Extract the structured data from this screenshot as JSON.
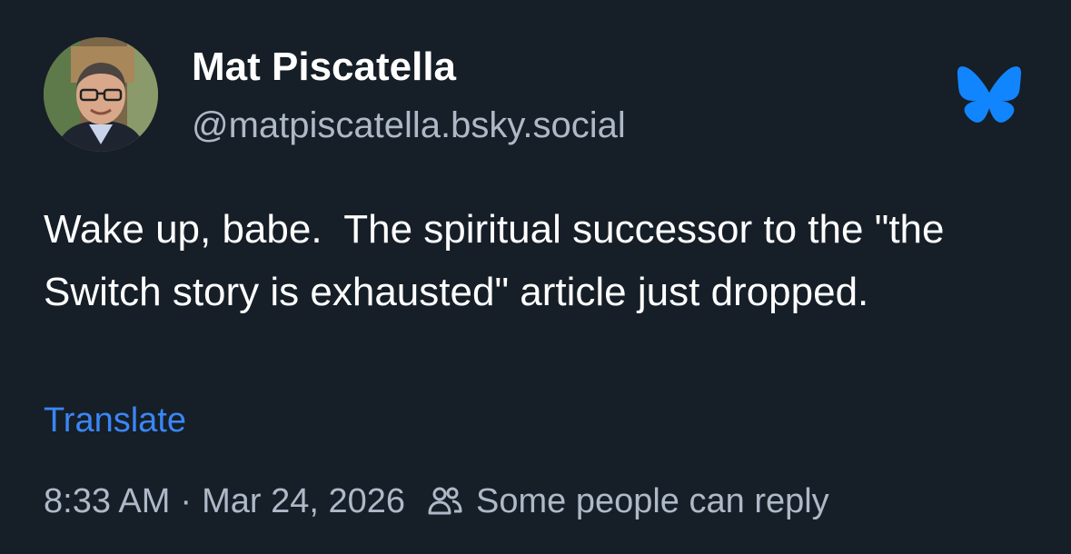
{
  "author": {
    "display_name": "Mat Piscatella",
    "handle": "@matpiscatella.bsky.social",
    "avatar_icon": "profile-photo"
  },
  "app": {
    "logo_icon": "bluesky-butterfly-icon",
    "accent_color": "#1185fe"
  },
  "post": {
    "text": "Wake up, babe.  The spiritual successor to the \"the Switch story is exhausted\" article just dropped.",
    "translate_label": "Translate"
  },
  "meta": {
    "time": "8:33 AM",
    "separator": "·",
    "date": "Mar 24, 2026",
    "reply_icon": "people-icon",
    "reply_setting": "Some people can reply"
  },
  "colors": {
    "background": "#161e27",
    "primary_text": "#ffffff",
    "secondary_text": "#aeb9c8",
    "link": "#3a86f5"
  }
}
